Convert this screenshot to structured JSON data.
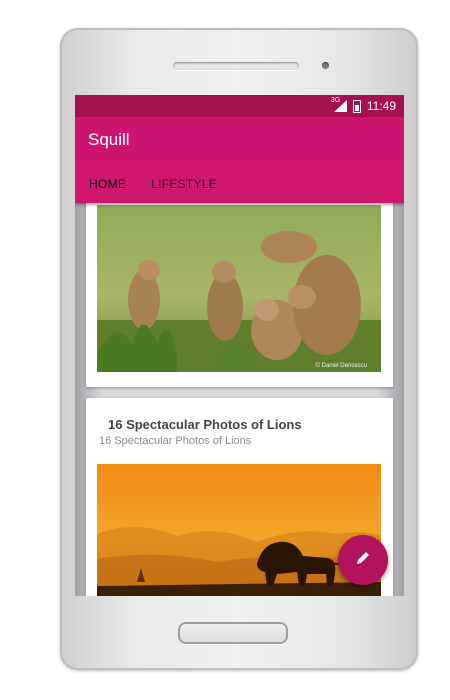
{
  "status_bar": {
    "network": "3G",
    "time": "11:49"
  },
  "app_bar": {
    "title": "Squill"
  },
  "tabs": [
    {
      "label": "HOME",
      "selected": true
    },
    {
      "label": "LIFESTYLE",
      "selected": false
    }
  ],
  "feed": {
    "cards": [
      {
        "image": "meerkats-photo",
        "watermark": "© Daniel Dencescu"
      },
      {
        "headline": "16 Spectacular Photos of Lions",
        "subtitle": "16 Spectacular Photos of Lions",
        "image": "lion-sunset-photo"
      }
    ]
  },
  "fab": {
    "icon": "pencil-icon"
  },
  "colors": {
    "status_bar": "#a5114f",
    "app_bar": "#cd1470",
    "fab": "#b3135d"
  }
}
